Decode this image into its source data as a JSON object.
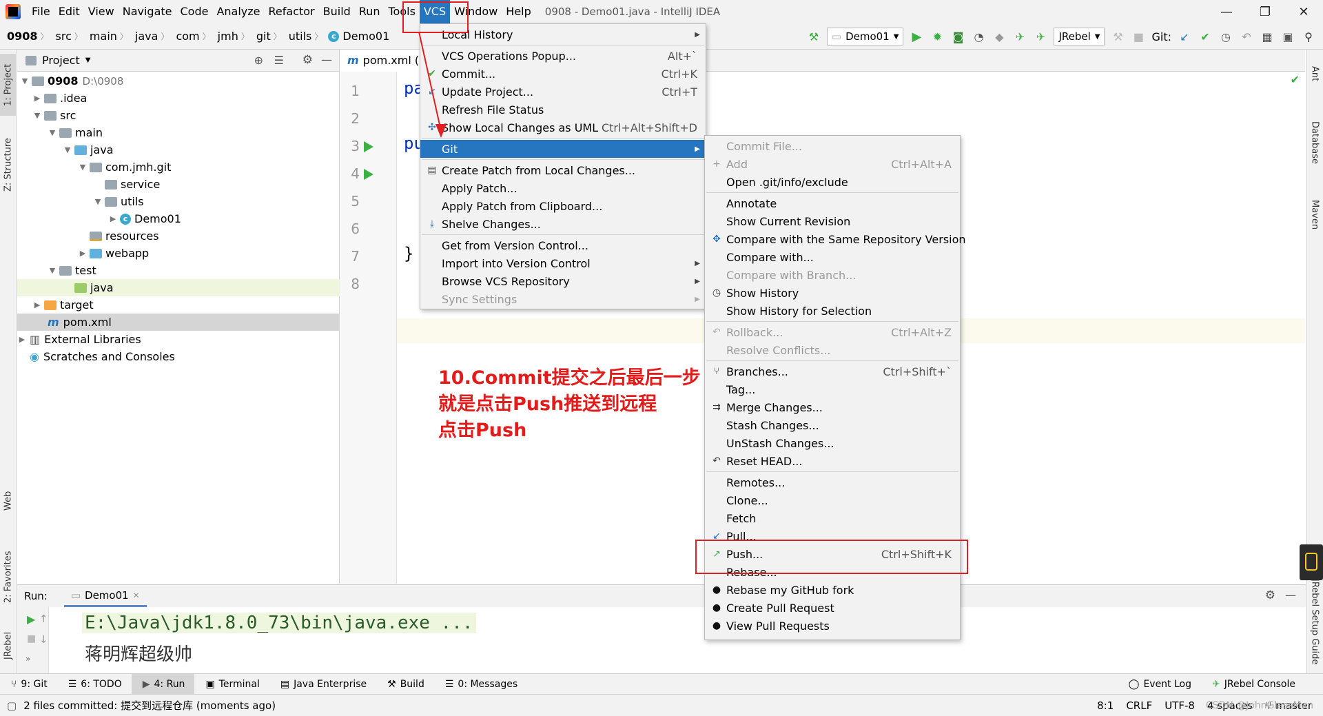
{
  "menubar": {
    "items": [
      "File",
      "Edit",
      "View",
      "Navigate",
      "Code",
      "Analyze",
      "Refactor",
      "Build",
      "Run",
      "Tools",
      "VCS",
      "Window",
      "Help"
    ],
    "title": "0908 - Demo01.java - IntelliJ IDEA"
  },
  "window_controls": {
    "minimize": "—",
    "restore": "❐",
    "close": "✕"
  },
  "breadcrumbs": [
    "0908",
    "src",
    "main",
    "java",
    "com",
    "jmh",
    "git",
    "utils",
    "Demo01"
  ],
  "toolbar": {
    "run_config": "Demo01",
    "jrebel": "JRebel",
    "git_label": "Git:"
  },
  "project_panel": {
    "title": "Project",
    "tree": [
      {
        "label": "0908",
        "extra": "D:\\0908"
      },
      {
        "label": ".idea"
      },
      {
        "label": "src"
      },
      {
        "label": "main"
      },
      {
        "label": "java"
      },
      {
        "label": "com.jmh.git"
      },
      {
        "label": "service"
      },
      {
        "label": "utils"
      },
      {
        "label": "Demo01"
      },
      {
        "label": "resources"
      },
      {
        "label": "webapp"
      },
      {
        "label": "test"
      },
      {
        "label": "java"
      },
      {
        "label": "target"
      },
      {
        "label": "pom.xml"
      },
      {
        "label": "External Libraries"
      },
      {
        "label": "Scratches and Consoles"
      }
    ]
  },
  "editor": {
    "tab": "pom.xml (0",
    "line_numbers": [
      "1",
      "2",
      "3",
      "4",
      "5",
      "6",
      "7",
      "8"
    ],
    "code_fragments": {
      "l1": "pa",
      "l3": "pu",
      "l7": "}"
    }
  },
  "vcs_menu": {
    "items": [
      {
        "label": "Local History",
        "shortcut": ""
      },
      {
        "label": "VCS Operations Popup...",
        "shortcut": "Alt+`"
      },
      {
        "label": "Commit...",
        "shortcut": "Ctrl+K"
      },
      {
        "label": "Update Project...",
        "shortcut": "Ctrl+T"
      },
      {
        "label": "Refresh File Status",
        "shortcut": ""
      },
      {
        "label": "Show Local Changes as UML",
        "shortcut": "Ctrl+Alt+Shift+D"
      },
      {
        "label": "Git",
        "shortcut": ""
      },
      {
        "label": "Create Patch from Local Changes...",
        "shortcut": ""
      },
      {
        "label": "Apply Patch...",
        "shortcut": ""
      },
      {
        "label": "Apply Patch from Clipboard...",
        "shortcut": ""
      },
      {
        "label": "Shelve Changes...",
        "shortcut": ""
      },
      {
        "label": "Get from Version Control...",
        "shortcut": ""
      },
      {
        "label": "Import into Version Control",
        "shortcut": ""
      },
      {
        "label": "Browse VCS Repository",
        "shortcut": ""
      },
      {
        "label": "Sync Settings",
        "shortcut": ""
      }
    ]
  },
  "git_menu": {
    "items": [
      {
        "label": "Commit File...",
        "shortcut": ""
      },
      {
        "label": "Add",
        "shortcut": "Ctrl+Alt+A"
      },
      {
        "label": "Open .git/info/exclude",
        "shortcut": ""
      },
      {
        "label": "Annotate",
        "shortcut": ""
      },
      {
        "label": "Show Current Revision",
        "shortcut": ""
      },
      {
        "label": "Compare with the Same Repository Version",
        "shortcut": ""
      },
      {
        "label": "Compare with...",
        "shortcut": ""
      },
      {
        "label": "Compare with Branch...",
        "shortcut": ""
      },
      {
        "label": "Show History",
        "shortcut": ""
      },
      {
        "label": "Show History for Selection",
        "shortcut": ""
      },
      {
        "label": "Rollback...",
        "shortcut": "Ctrl+Alt+Z"
      },
      {
        "label": "Resolve Conflicts...",
        "shortcut": ""
      },
      {
        "label": "Branches...",
        "shortcut": "Ctrl+Shift+`"
      },
      {
        "label": "Tag...",
        "shortcut": ""
      },
      {
        "label": "Merge Changes...",
        "shortcut": ""
      },
      {
        "label": "Stash Changes...",
        "shortcut": ""
      },
      {
        "label": "UnStash Changes...",
        "shortcut": ""
      },
      {
        "label": "Reset HEAD...",
        "shortcut": ""
      },
      {
        "label": "Remotes...",
        "shortcut": ""
      },
      {
        "label": "Clone...",
        "shortcut": ""
      },
      {
        "label": "Fetch",
        "shortcut": ""
      },
      {
        "label": "Pull...",
        "shortcut": ""
      },
      {
        "label": "Push...",
        "shortcut": "Ctrl+Shift+K"
      },
      {
        "label": "Rebase...",
        "shortcut": ""
      },
      {
        "label": "Rebase my GitHub fork",
        "shortcut": ""
      },
      {
        "label": "Create Pull Request",
        "shortcut": ""
      },
      {
        "label": "View Pull Requests",
        "shortcut": ""
      }
    ]
  },
  "annotation": {
    "lines": [
      "10.Commit提交之后最后一步",
      "就是点击Push推送到远程",
      "点击Push"
    ],
    "color": "#e21b1b"
  },
  "run_panel": {
    "label": "Run:",
    "tab": "Demo01",
    "console": [
      "E:\\Java\\jdk1.8.0_73\\bin\\java.exe ...",
      "蒋明辉超级帅"
    ]
  },
  "left_tools": [
    "1: Project",
    "Z: Structure",
    "Web",
    "2: Favorites",
    "JRebel"
  ],
  "right_tools": [
    "Ant",
    "Database",
    "Maven",
    "JRebel Setup Guide"
  ],
  "bottom_tabs": [
    "9: Git",
    "6: TODO",
    "4: Run",
    "Terminal",
    "Java Enterprise",
    "Build",
    "0: Messages"
  ],
  "bottom_right_tabs": [
    "Event Log",
    "JRebel Console"
  ],
  "status": {
    "message": "2 files committed: 提交到远程仓库 (moments ago)",
    "position": "8:1",
    "line_sep": "CRLF",
    "encoding": "UTF-8",
    "indent": "4 spaces",
    "branch": "master",
    "watermark": "CSDN @JohnGlassMan"
  },
  "colors": {
    "accent": "#2675bf",
    "highlight_box": "#e02020",
    "run_green": "#3cb043"
  }
}
